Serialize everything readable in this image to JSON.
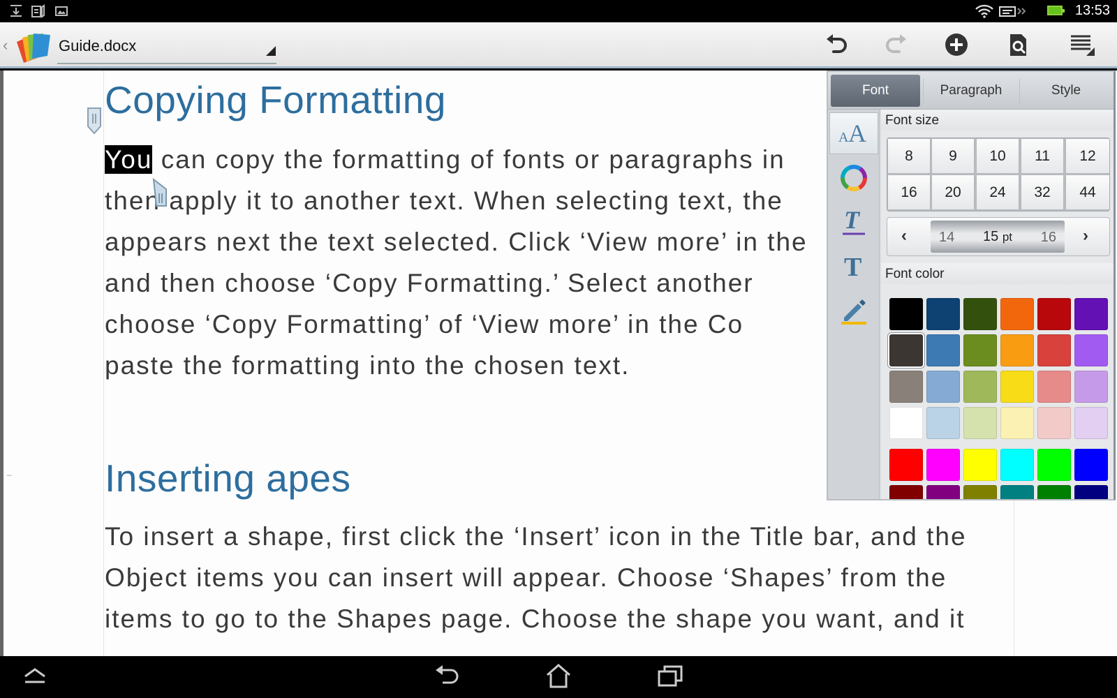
{
  "status_bar": {
    "clock": "13:53",
    "icons": [
      "download-icon",
      "notes-icon",
      "image-icon",
      "wifi-icon",
      "data-icon",
      "battery-icon"
    ]
  },
  "toolbar": {
    "doc_title": "Guide.docx",
    "buttons": [
      "undo-icon",
      "redo-icon",
      "insert-icon",
      "find-icon",
      "menu-icon"
    ]
  },
  "document": {
    "heading1": "Copying Formatting",
    "para1_selected": "You",
    "para1_lines": [
      " can copy the formatting of fonts or paragraphs in",
      "then apply it to another text. When selecting text, the",
      "appears next the text selected. Click  ‘View more’ in the",
      "and then choose  ‘Copy Formatting.’ Select another",
      "choose  ‘Copy Formatting’ of  ‘View more’ in the Co",
      "paste the formatting into the chosen text."
    ],
    "heading2": "Inserting apes",
    "para2_lines": [
      "To insert a shape, first click the  ‘Insert’ icon in the Title bar, and the",
      "Object items you can insert will appear. Choose  ‘Shapes’ from the",
      "items to go to the Shapes page. Choose the shape you want, and it"
    ]
  },
  "format_panel": {
    "tabs": [
      {
        "label": "Font",
        "active": true
      },
      {
        "label": "Paragraph",
        "active": false
      },
      {
        "label": "Style",
        "active": false
      }
    ],
    "side_tools": [
      "font-size-icon",
      "color-wheel-icon",
      "text-underline-icon",
      "text-style-icon",
      "highlight-pen-icon"
    ],
    "font_size_label": "Font size",
    "font_sizes": [
      "8",
      "9",
      "10",
      "11",
      "12",
      "16",
      "20",
      "24",
      "32",
      "44"
    ],
    "stepper": {
      "prev": "14",
      "current": "15",
      "unit": "pt",
      "next": "16"
    },
    "font_color_label": "Font color",
    "colors": [
      [
        "#000000",
        "#0d4273",
        "#33510c",
        "#f3670c",
        "#b8080c",
        "#6310b5"
      ],
      [
        "#3b3632",
        "#3d79b3",
        "#6b8d1f",
        "#f99c12",
        "#d8413c",
        "#a25bf1"
      ],
      [
        "#8a807a",
        "#85aad3",
        "#9fb95a",
        "#f7dc17",
        "#e68b8a",
        "#c59be9"
      ],
      [
        "#ffffff",
        "#bad3e7",
        "#d6e2ad",
        "#fbf1b2",
        "#f2cbc9",
        "#e2cff2"
      ],
      [
        "#ff0000",
        "#ff00ff",
        "#ffff00",
        "#00ffff",
        "#00ff00",
        "#0000ff"
      ],
      [
        "#800000",
        "#800080",
        "#808000",
        "#008080",
        "#008000",
        "#000080"
      ]
    ],
    "selected_color": "#3b3632"
  },
  "nav_bar": {
    "buttons": [
      "collapse-icon",
      "back-icon",
      "home-icon",
      "recent-apps-icon"
    ]
  }
}
